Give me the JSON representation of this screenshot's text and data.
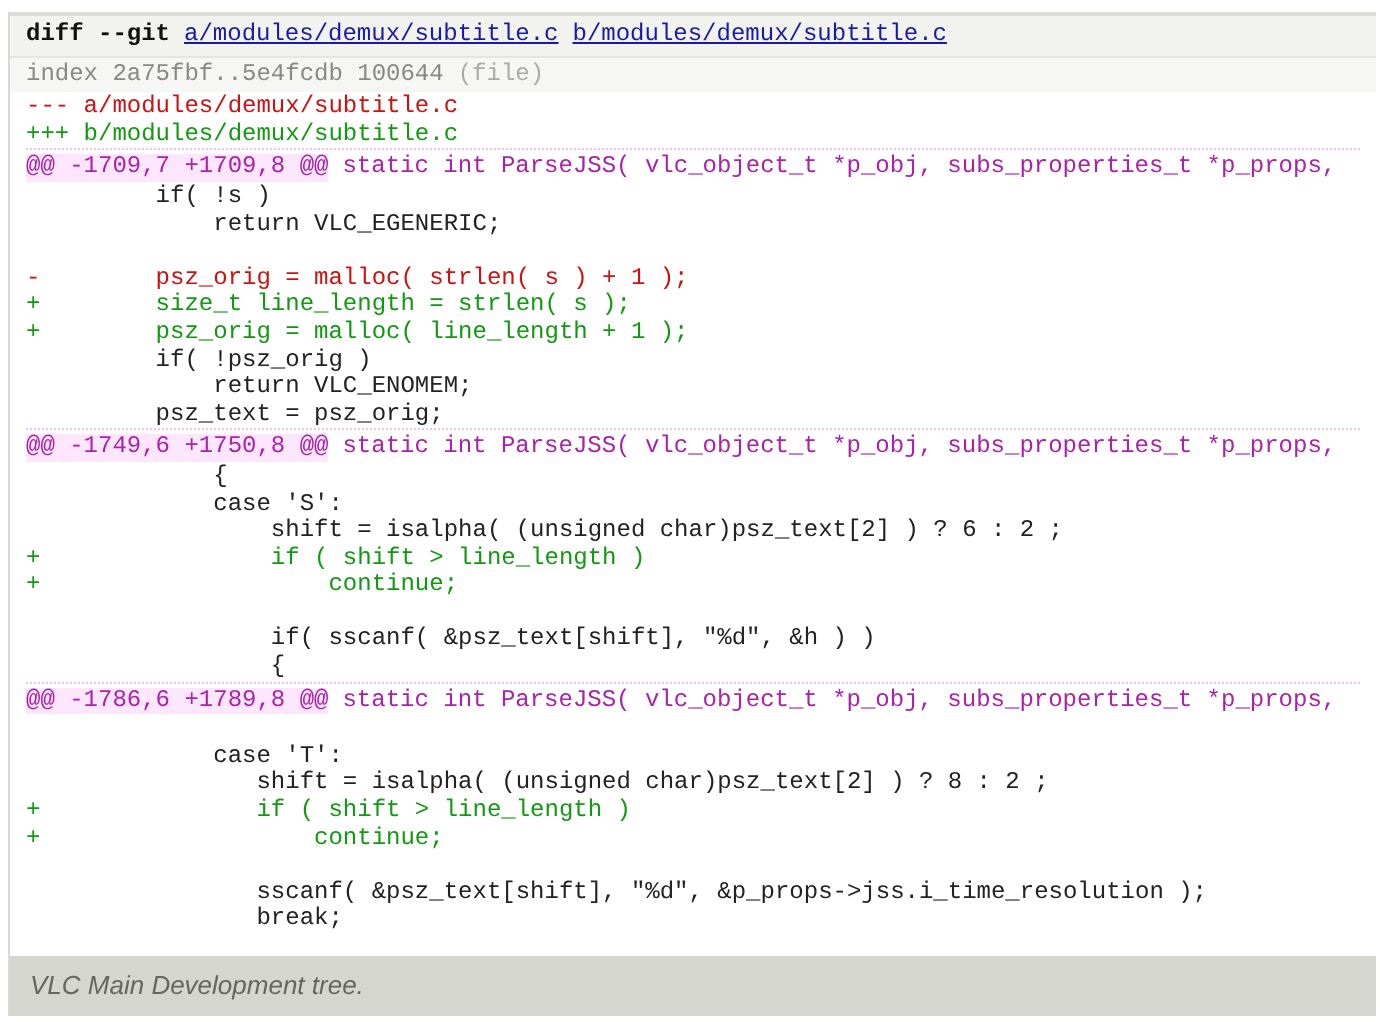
{
  "diff_header": {
    "command": "diff --git",
    "a_path": "a/modules/demux/subtitle.c",
    "b_path": "b/modules/demux/subtitle.c"
  },
  "index_line": {
    "text": "index 2a75fbf..5e4fcdb 100644",
    "mode": "(file)"
  },
  "from_file": "--- a/modules/demux/subtitle.c",
  "to_file": "+++ b/modules/demux/subtitle.c",
  "lines": [
    {
      "kind": "hunk",
      "range": "@@ -1709,7 +1709,8 @@",
      "section": "static int ParseJSS( vlc_object_t *p_obj, subs_properties_t *p_props,"
    },
    {
      "kind": "context",
      "text": "         if( !s )"
    },
    {
      "kind": "context",
      "text": "             return VLC_EGENERIC;"
    },
    {
      "kind": "blank"
    },
    {
      "kind": "del",
      "text": "-        psz_orig = malloc( strlen( s ) + 1 );"
    },
    {
      "kind": "add",
      "text": "+        size_t line_length = strlen( s );"
    },
    {
      "kind": "add",
      "text": "+        psz_orig = malloc( line_length + 1 );"
    },
    {
      "kind": "context",
      "text": "         if( !psz_orig )"
    },
    {
      "kind": "context",
      "text": "             return VLC_ENOMEM;"
    },
    {
      "kind": "context",
      "text": "         psz_text = psz_orig;"
    },
    {
      "kind": "hunk",
      "range": "@@ -1749,6 +1750,8 @@",
      "section": "static int ParseJSS( vlc_object_t *p_obj, subs_properties_t *p_props,"
    },
    {
      "kind": "context",
      "text": "             {"
    },
    {
      "kind": "context",
      "text": "             case 'S':"
    },
    {
      "kind": "context",
      "text": "                 shift = isalpha( (unsigned char)psz_text[2] ) ? 6 : 2 ;"
    },
    {
      "kind": "add",
      "text": "+                if ( shift > line_length )"
    },
    {
      "kind": "add",
      "text": "+                    continue;"
    },
    {
      "kind": "blank"
    },
    {
      "kind": "context",
      "text": "                 if( sscanf( &psz_text[shift], \"%d\", &h ) )"
    },
    {
      "kind": "context",
      "text": "                 {"
    },
    {
      "kind": "hunk",
      "range": "@@ -1786,6 +1789,8 @@",
      "section": "static int ParseJSS( vlc_object_t *p_obj, subs_properties_t *p_props,"
    },
    {
      "kind": "blank"
    },
    {
      "kind": "context",
      "text": "             case 'T':"
    },
    {
      "kind": "context",
      "text": "                shift = isalpha( (unsigned char)psz_text[2] ) ? 8 : 2 ;"
    },
    {
      "kind": "add",
      "text": "+               if ( shift > line_length )"
    },
    {
      "kind": "add",
      "text": "+                   continue;"
    },
    {
      "kind": "blank"
    },
    {
      "kind": "context",
      "text": "                sscanf( &psz_text[shift], \"%d\", &p_props->jss.i_time_resolution );"
    },
    {
      "kind": "context",
      "text": "                break;"
    }
  ],
  "caption": "VLC Main Development tree."
}
